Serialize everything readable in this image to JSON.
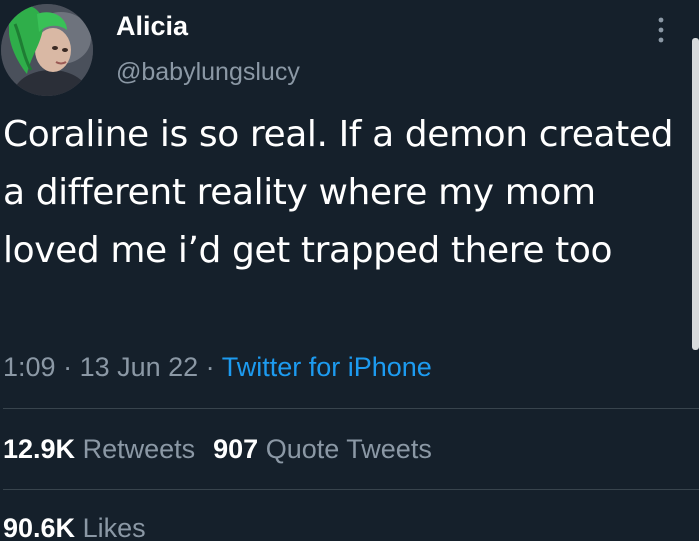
{
  "colors": {
    "background": "#15202b",
    "primary_text": "#ffffff",
    "secondary_text": "#8b98a5",
    "link": "#1d9bf0",
    "divider": "#38444d"
  },
  "user": {
    "display_name": "Alicia",
    "handle": "@babylungslucy",
    "avatar_icon": "profile-avatar"
  },
  "header": {
    "more_icon": "more-vertical-icon"
  },
  "tweet": {
    "text": "Coraline is so real. If a demon created a different reality where my mom loved me i’d get trapped there too",
    "time": "1:09",
    "separator": " · ",
    "date": "13 Jun 22",
    "source": "Twitter for iPhone"
  },
  "stats": {
    "retweets": {
      "count": "12.9K",
      "label": "Retweets"
    },
    "quote_tweets": {
      "count": "907",
      "label": "Quote Tweets"
    },
    "likes": {
      "count": "90.6K",
      "label": "Likes"
    }
  }
}
